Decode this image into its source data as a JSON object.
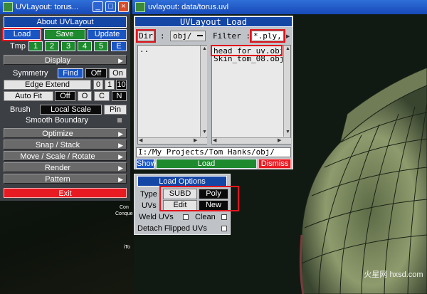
{
  "left_window": {
    "title": "UVLayout: torus...",
    "panel_title": "About UVLayout",
    "load_button": "Load",
    "save_button": "Save",
    "update_button": "Update",
    "tmp_label": "Tmp",
    "tmp_slots": [
      "1",
      "2",
      "3",
      "4",
      "5",
      "E"
    ],
    "menus": {
      "display": "Display",
      "optimize": "Optimize",
      "snap_stack": "Snap / Stack",
      "move_scale_rotate": "Move / Scale / Rotate",
      "render": "Render",
      "pattern": "Pattern"
    },
    "symmetry_label": "Symmetry",
    "symmetry_find": "Find",
    "symmetry_off": "Off",
    "symmetry_on": "On",
    "edge_extend_label": "Edge Extend",
    "edge_extend_values": [
      "0",
      "1",
      "10"
    ],
    "auto_fit_label": "Auto Fit",
    "auto_fit_values": [
      "Off",
      "O",
      "C",
      "N"
    ],
    "brush_label": "Brush",
    "brush_mode": "Local Scale",
    "brush_pin": "Pin",
    "smooth_boundary_label": "Smooth Boundary",
    "exit_button": "Exit"
  },
  "main_window": {
    "title": "uvlayout: data/torus.uvl"
  },
  "load_dialog": {
    "title": "UVLayout Load",
    "dir_button": "Dir",
    "colon": ":",
    "dir_value": "obj/",
    "filter_label": "Filter :",
    "filter_value": "*.ply,",
    "folders": [
      ".."
    ],
    "files": [
      "head_for_uv.obj",
      "Skin_tom_08.obj"
    ],
    "path": "I:/My Projects/Tom Hanks/obj/",
    "show_button": "Show",
    "load_button": "Load",
    "dismiss_button": "Dismiss"
  },
  "load_options": {
    "title": "Load Options",
    "type_label": "Type",
    "type_values": [
      "SUBD",
      "Poly"
    ],
    "uvs_label": "UVs",
    "uvs_values": [
      "Edit",
      "New"
    ],
    "weld_uvs_label": "Weld UVs",
    "clean_label": "Clean",
    "detach_label": "Detach Flipped UVs"
  },
  "desktop": {
    "icon_label_1": "Con",
    "icon_label_2": "Conque",
    "icon_label_3": "iTo"
  },
  "watermark": "火星网 hxsd.com"
}
